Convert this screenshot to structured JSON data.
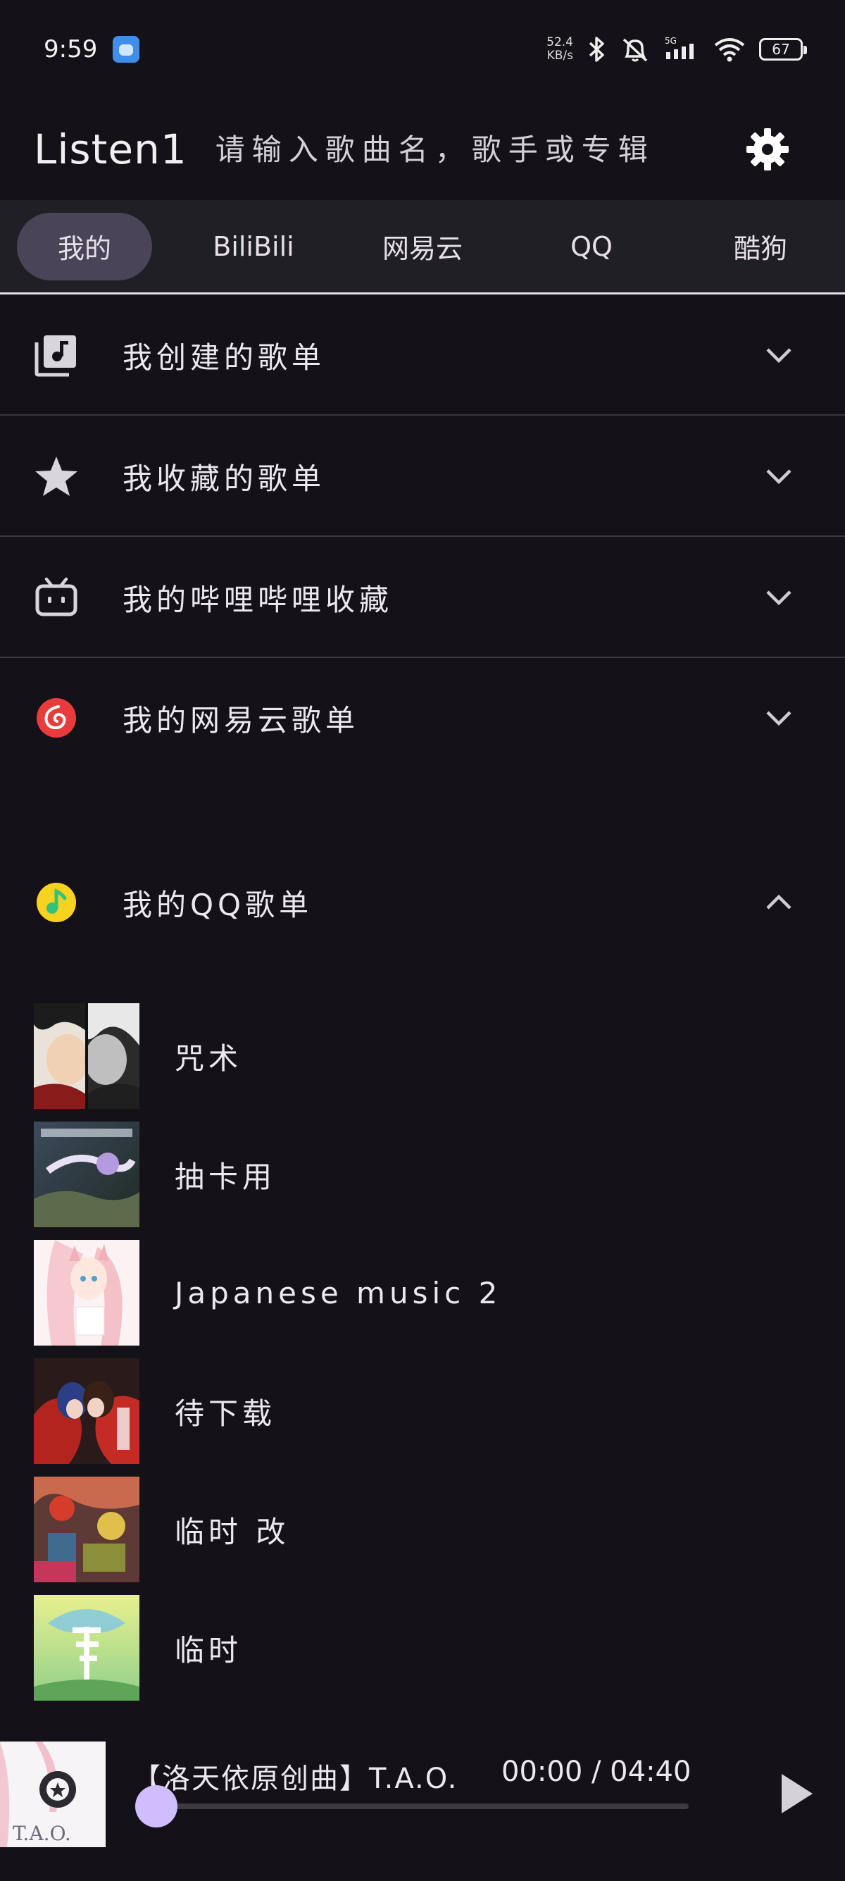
{
  "status": {
    "time": "9:59",
    "net_speed_value": "52.4",
    "net_speed_unit": "KB/s",
    "network": "5G",
    "battery": "67"
  },
  "appbar": {
    "title": "Listen1",
    "search_placeholder": "请输入歌曲名，歌手或专辑"
  },
  "tabs": [
    {
      "label": "我的",
      "active": true
    },
    {
      "label": "BiliBili",
      "active": false
    },
    {
      "label": "网易云",
      "active": false
    },
    {
      "label": "QQ",
      "active": false
    },
    {
      "label": "酷狗",
      "active": false
    }
  ],
  "sections": [
    {
      "label": "我创建的歌单",
      "icon": "playlist-music-icon",
      "expanded": false
    },
    {
      "label": "我收藏的歌单",
      "icon": "star-icon",
      "expanded": false
    },
    {
      "label": "我的哔哩哔哩收藏",
      "icon": "bilibili-tv-icon",
      "expanded": false
    },
    {
      "label": "我的网易云歌单",
      "icon": "netease-cloud-icon",
      "expanded": false
    },
    {
      "label": "我的QQ歌单",
      "icon": "qq-music-icon",
      "expanded": true
    }
  ],
  "qq_playlists": [
    {
      "name": "咒术"
    },
    {
      "name": "抽卡用"
    },
    {
      "name": "Japanese music 2"
    },
    {
      "name": "待下载"
    },
    {
      "name": "临时  改"
    },
    {
      "name": "临时"
    }
  ],
  "player": {
    "title": "【洛天依原创曲】T.A.O.",
    "time": "00:00 / 04:40",
    "progress": 0,
    "cover_text": "T.A.O."
  },
  "colors": {
    "background": "#141218",
    "tab_bar": "#211f26",
    "active_tab": "#4a4458",
    "accent": "#cfbdfe",
    "netease_red": "#e83c3c",
    "qq_yellow": "#f7d21e",
    "qq_green": "#31c27c"
  }
}
